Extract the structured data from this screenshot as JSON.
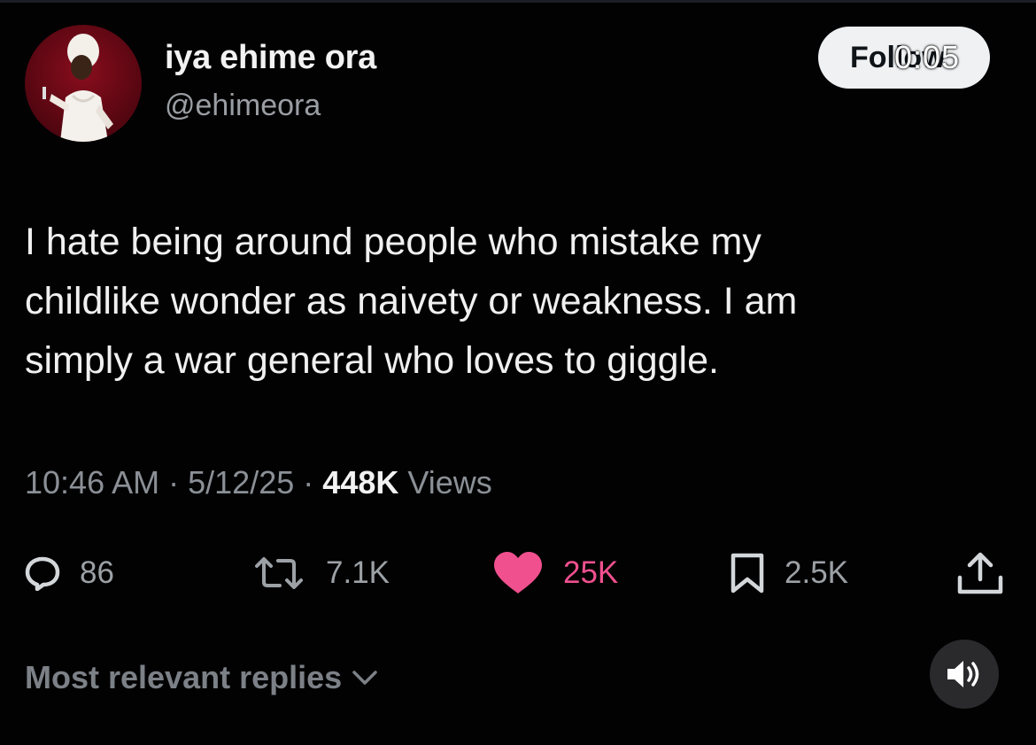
{
  "user": {
    "display_name": "iya ehime ora",
    "handle": "@ehimeora",
    "avatar_icon": "profile-photo"
  },
  "follow_button": {
    "label": "Follow"
  },
  "video_overlay": {
    "timer": "0:05",
    "sound_icon": "speaker-icon"
  },
  "tweet": {
    "lines": [
      "I hate being around people who mistake my",
      "childlike wonder as naivety or weakness. I am",
      "simply a war general who loves to giggle."
    ]
  },
  "meta": {
    "time": "10:46 AM",
    "separator": "·",
    "date": "5/12/25",
    "views_count": "448K",
    "views_label": "Views"
  },
  "actions": {
    "replies": "86",
    "reposts": "7.1K",
    "likes": "25K",
    "bookmarks": "2.5K"
  },
  "footer": {
    "replies_sort_label": "Most relevant replies"
  },
  "colors": {
    "background": "#000000",
    "like_accent": "#f0508e",
    "muted_text": "#8b9096"
  }
}
